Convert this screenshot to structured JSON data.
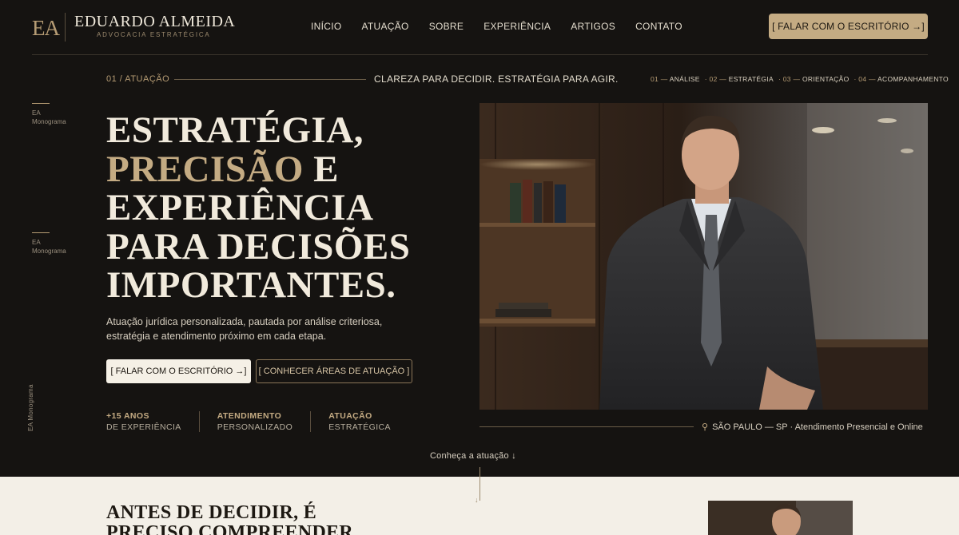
{
  "brand": {
    "monogram": "EA",
    "name": "EDUARDO ALMEIDA",
    "subtitle": "ADVOCACIA ESTRATÉGICA"
  },
  "nav": {
    "items": [
      "INÍCIO",
      "ATUAÇÃO",
      "SOBRE",
      "EXPERIÊNCIA",
      "ARTIGOS",
      "CONTATO"
    ]
  },
  "header_cta": "[ FALAR COM O ESCRITÓRIO →]",
  "subrow": {
    "kicker": "01 / ATUAÇÃO",
    "tagline": "CLAREZA PARA DECIDIR. ESTRATÉGIA PARA AGIR.",
    "steps": [
      {
        "num": "01 —",
        "label": "ANÁLISE"
      },
      {
        "num": "· 02 —",
        "label": "ESTRATÉGIA"
      },
      {
        "num": "· 03 —",
        "label": "ORIENTAÇÃO"
      },
      {
        "num": "· 04 —",
        "label": "ACOMPANHAMENTO"
      }
    ]
  },
  "side": {
    "mark1_a": "EA",
    "mark1_b": "Monograma",
    "mark2_a": "EA",
    "mark2_b": "Monograma",
    "vertical": "EA Monograma"
  },
  "hero": {
    "line1": "ESTRATÉGIA,",
    "line2_gold": "PRECISÃO",
    "line2_rest": " E",
    "line3": "EXPERIÊNCIA",
    "line4": "PARA DECISÕES",
    "line5": "IMPORTANTES.",
    "text": "Atuação jurídica personalizada, pautada por análise criteriosa, estratégia e atendimento próximo em cada etapa.",
    "btn_primary": "[ FALAR COM O ESCRITÓRIO →]",
    "btn_secondary": "[ CONHECER ÁREAS DE ATUAÇÃO ]"
  },
  "stats": [
    {
      "top": "+15 ANOS",
      "bottom": "DE EXPERIÊNCIA"
    },
    {
      "top": "ATENDIMENTO",
      "bottom": "PERSONALIZADO"
    },
    {
      "top": "ATUAÇÃO",
      "bottom": "ESTRATÉGICA"
    }
  ],
  "location": "SÃO PAULO — SP · Atendimento Presencial e Online",
  "scroll_cue": "Conheça a atuação ↓",
  "section2": {
    "title_line1": "ANTES DE DECIDIR, É",
    "title_line2": "PRECISO COMPREENDER"
  },
  "colors": {
    "background": "#151311",
    "accent_gold": "#c4ab83",
    "light_section": "#f3efe7"
  }
}
